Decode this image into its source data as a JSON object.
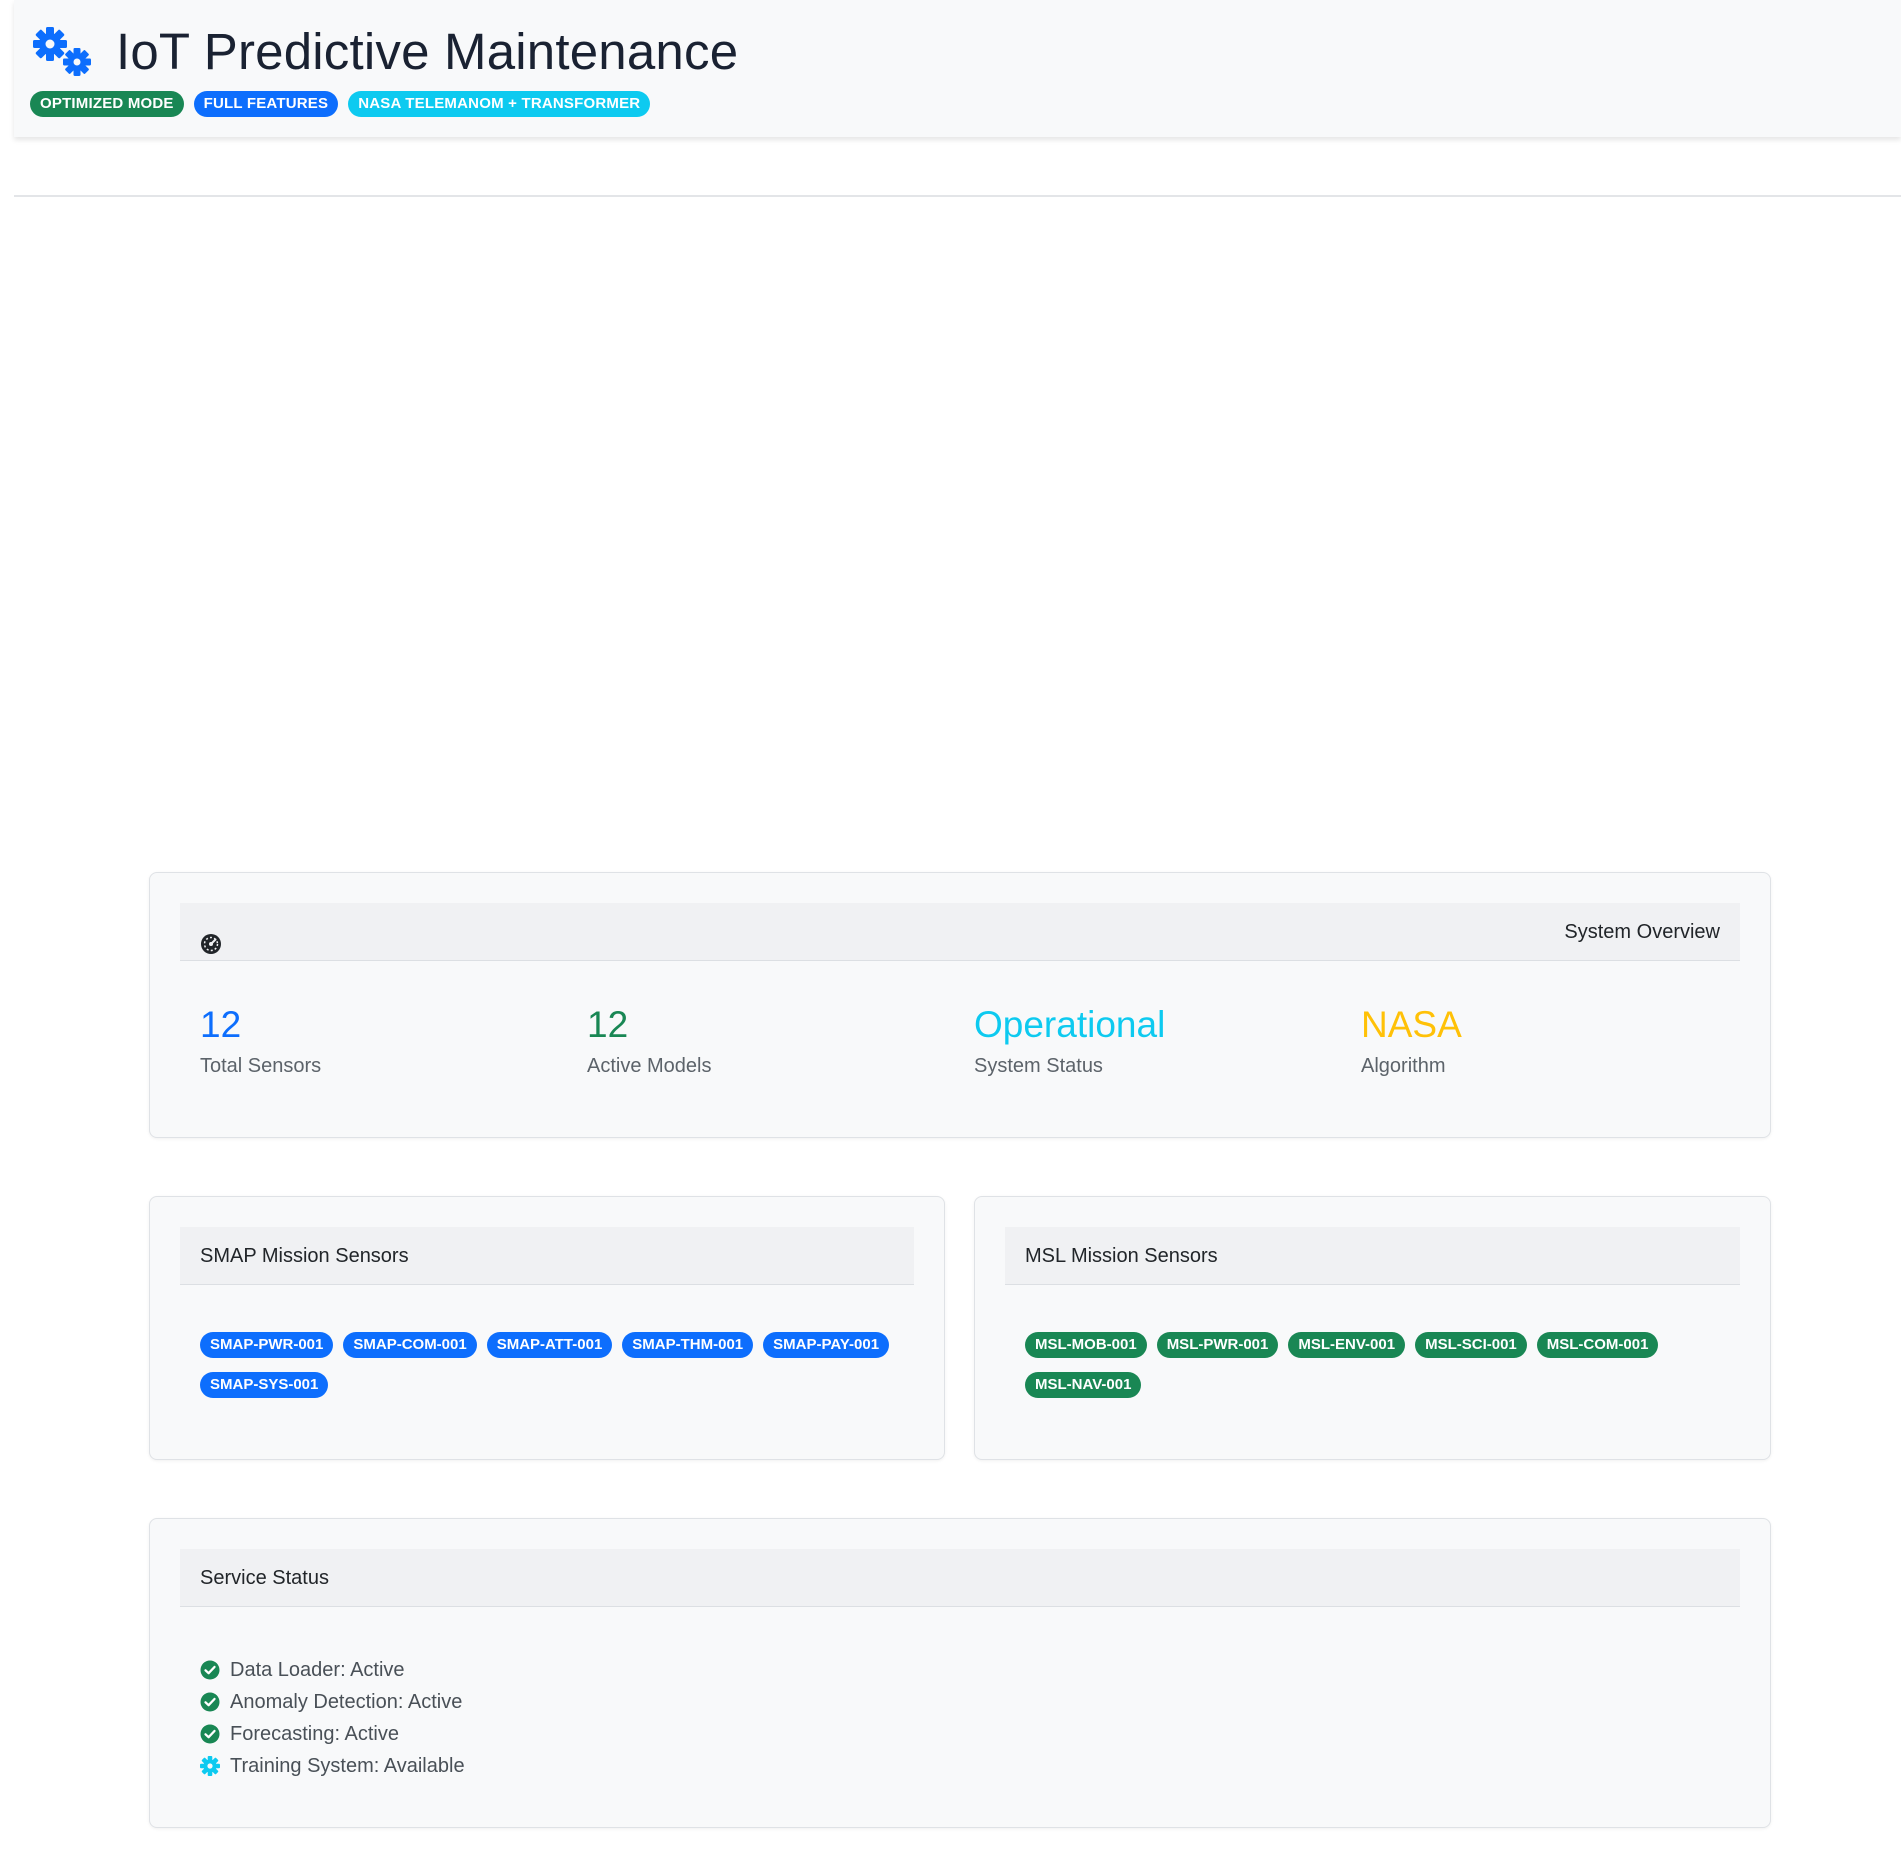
{
  "header": {
    "title": "IoT Predictive Maintenance",
    "icon": "gears-icon",
    "badges": [
      {
        "label": "OPTIMIZED MODE",
        "color": "#198754"
      },
      {
        "label": "FULL FEATURES",
        "color": "#0d6efd"
      },
      {
        "label": "NASA TELEMANOM + TRANSFORMER",
        "color": "#0dcaf0"
      }
    ]
  },
  "overview": {
    "title": "System Overview",
    "icon": "dashboard-icon",
    "stats": [
      {
        "value": "12",
        "label": "Total Sensors",
        "color": "#0d6efd"
      },
      {
        "value": "12",
        "label": "Active Models",
        "color": "#198754"
      },
      {
        "value": "Operational",
        "label": "System Status",
        "color": "#0dcaf0"
      },
      {
        "value": "NASA",
        "label": "Algorithm",
        "color": "#ffc107"
      }
    ]
  },
  "smap": {
    "title": "SMAP Mission Sensors",
    "color": "#0d6efd",
    "sensors": [
      "SMAP-PWR-001",
      "SMAP-COM-001",
      "SMAP-ATT-001",
      "SMAP-THM-001",
      "SMAP-PAY-001",
      "SMAP-SYS-001"
    ]
  },
  "msl": {
    "title": "MSL Mission Sensors",
    "color": "#198754",
    "sensors": [
      "MSL-MOB-001",
      "MSL-PWR-001",
      "MSL-ENV-001",
      "MSL-SCI-001",
      "MSL-COM-001",
      "MSL-NAV-001"
    ]
  },
  "services": {
    "title": "Service Status",
    "items": [
      {
        "label": "Data Loader: Active",
        "icon": "check-circle-icon",
        "color": "#198754"
      },
      {
        "label": "Anomaly Detection: Active",
        "icon": "check-circle-icon",
        "color": "#198754"
      },
      {
        "label": "Forecasting: Active",
        "icon": "check-circle-icon",
        "color": "#198754"
      },
      {
        "label": "Training System: Available",
        "icon": "gear-icon",
        "color": "#0dcaf0"
      }
    ]
  }
}
